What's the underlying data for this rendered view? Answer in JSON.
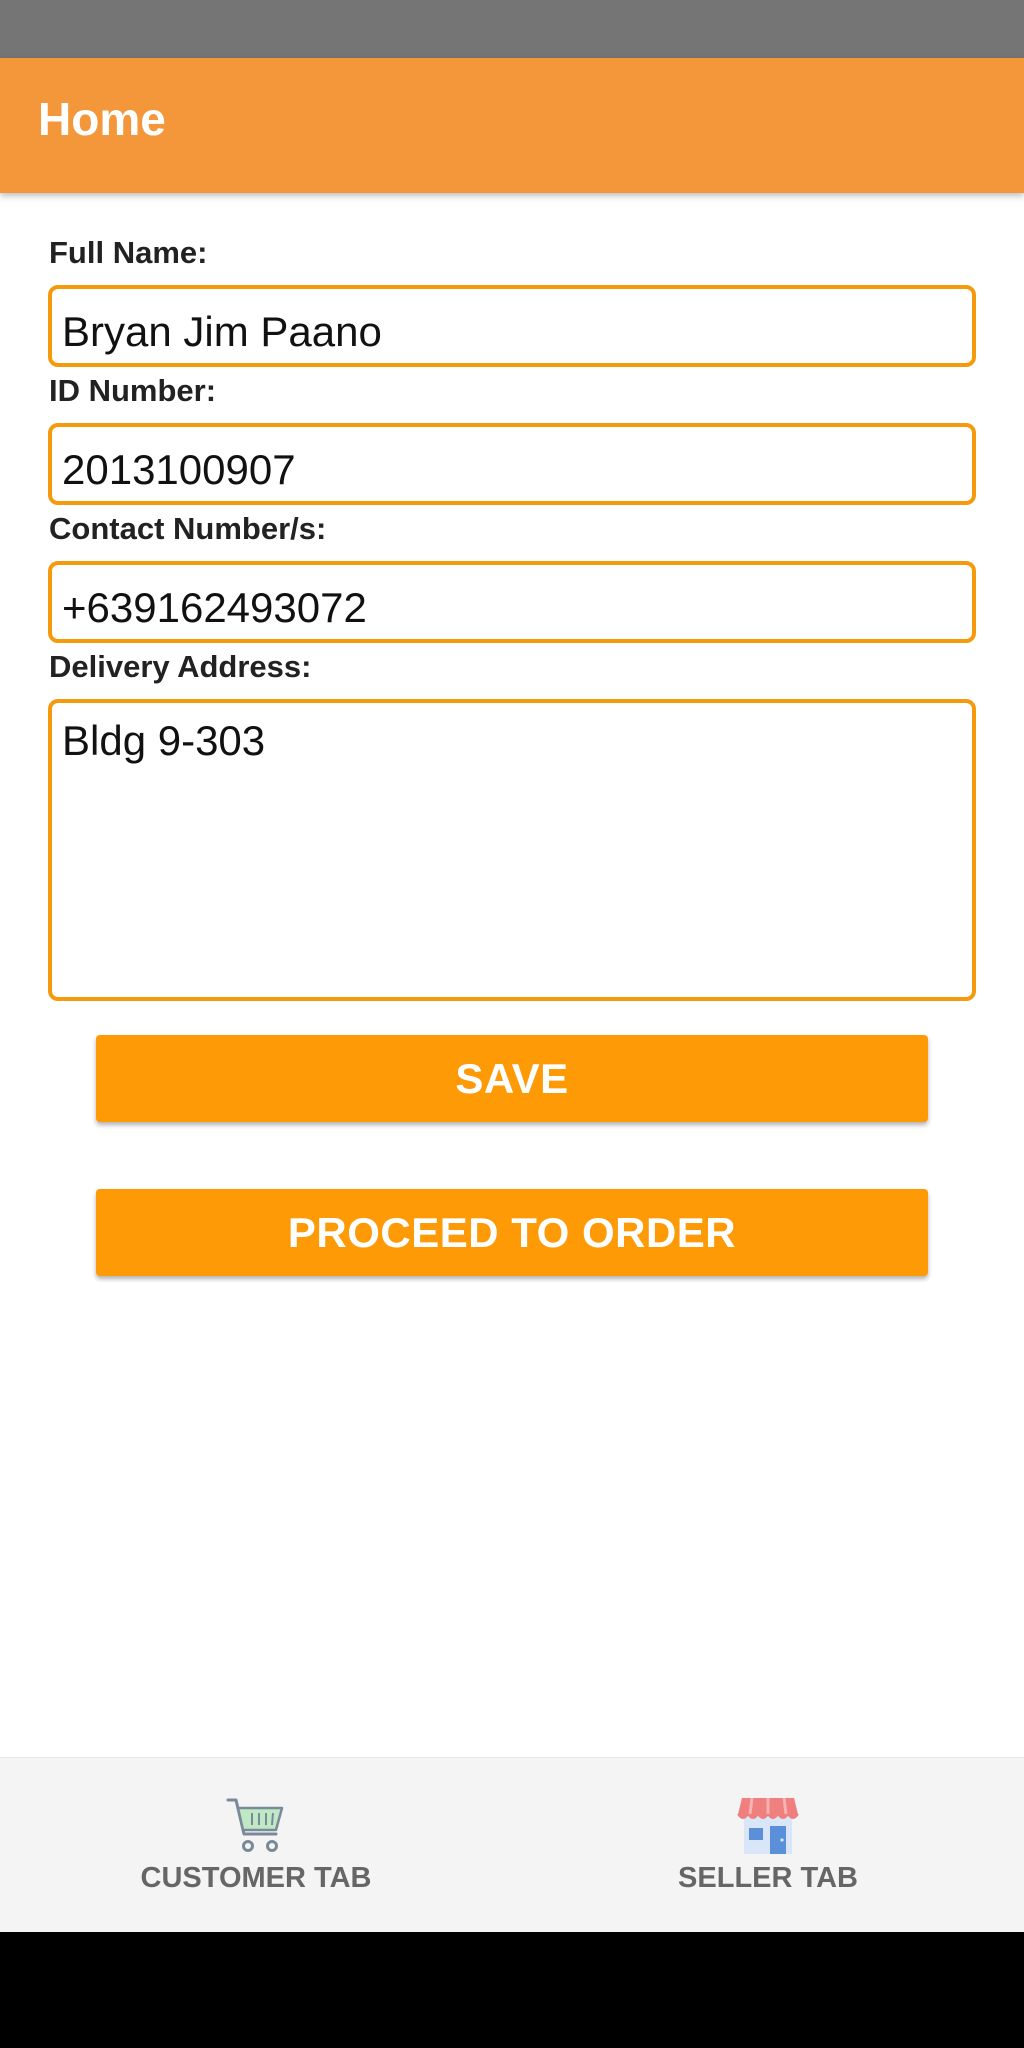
{
  "app_bar": {
    "title": "Home",
    "color": "#f4963a"
  },
  "form": {
    "full_name": {
      "label": "Full Name:",
      "value": "Bryan Jim Paano"
    },
    "id_number": {
      "label": "ID Number:",
      "value": "2013100907"
    },
    "contact": {
      "label": "Contact Number/s:",
      "value": "+639162493072"
    },
    "address": {
      "label": "Delivery Address:",
      "value": "Bldg 9-303"
    },
    "border_color": "#f59a0c"
  },
  "buttons": {
    "save": "SAVE",
    "proceed": "PROCEED TO ORDER",
    "color": "#fd9a05"
  },
  "bottom_nav": {
    "customer": {
      "label": "CUSTOMER TAB",
      "icon": "shopping-cart-icon"
    },
    "seller": {
      "label": "SELLER TAB",
      "icon": "storefront-icon"
    }
  }
}
